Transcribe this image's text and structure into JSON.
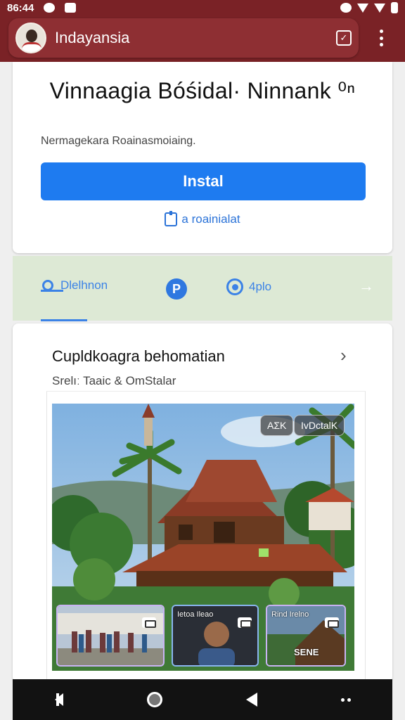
{
  "status_bar": {
    "time": "86:44"
  },
  "app_bar": {
    "title": "Indayansia"
  },
  "install_card": {
    "app_name": "Vinnaagia Bóśidal· Ninnank ⁰ⁿ",
    "description": "Nermagekara Roainasmoiaing.",
    "install_label": "Instal",
    "link_label": "a roainialat"
  },
  "tabs": [
    {
      "label": "Dlelhnon"
    },
    {
      "label": "P"
    },
    {
      "label": "4plo"
    }
  ],
  "tab_arrow": "→",
  "section": {
    "title": "Cupldkoagra behomatian",
    "subtitle": "Srelıː Taaic & OmStalar",
    "chevron": "›"
  },
  "hero": {
    "chip_1": "ΑΣΚ",
    "chip_2": "IvDctalK",
    "thumbs": [
      {
        "label": "",
        "big": ""
      },
      {
        "label": "Ietoa Ileao",
        "big": ""
      },
      {
        "label": "Rind Irelno",
        "big": "SENE"
      }
    ]
  },
  "colors": {
    "app_bar": "#7a2226",
    "install_button": "#1e7bf0",
    "tab_accent": "#3b82e6",
    "tab_strip": "#dde9d5"
  },
  "icons": {
    "status": [
      "circle-icon",
      "square-icon",
      "shield-icon",
      "wifi-icon",
      "signal-icon",
      "battery-icon"
    ],
    "app_bar": [
      "avatar",
      "check-square-icon",
      "overflow-menu-icon"
    ],
    "nav": [
      "back-icon",
      "home-icon",
      "triangle-back-icon",
      "dots-icon"
    ]
  }
}
